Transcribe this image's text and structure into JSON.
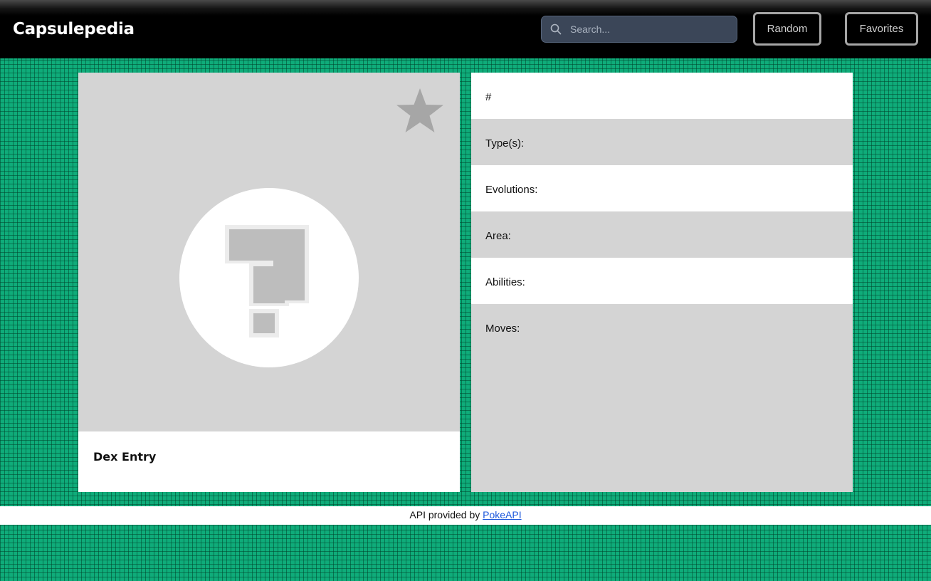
{
  "header": {
    "title": "Capsulepedia",
    "search": {
      "placeholder": "Search...",
      "value": ""
    },
    "random_label": "Random",
    "favorites_label": "Favorites"
  },
  "entry_card": {
    "favorite_icon": "star-icon",
    "image_icon": "question-mark-placeholder-icon",
    "dex_entry_label": "Dex Entry"
  },
  "details": {
    "rows": [
      {
        "label": "#",
        "value": ""
      },
      {
        "label": "Type(s):",
        "value": ""
      },
      {
        "label": "Evolutions:",
        "value": ""
      },
      {
        "label": "Area:",
        "value": ""
      },
      {
        "label": "Abilities:",
        "value": ""
      },
      {
        "label": "Moves:",
        "value": ""
      }
    ]
  },
  "footer": {
    "text": "API provided by ",
    "link_label": "PokeAPI"
  },
  "colors": {
    "background": "#0fac7a",
    "header": "#000000",
    "card": "#d4d4d4",
    "link": "#1a56db"
  }
}
